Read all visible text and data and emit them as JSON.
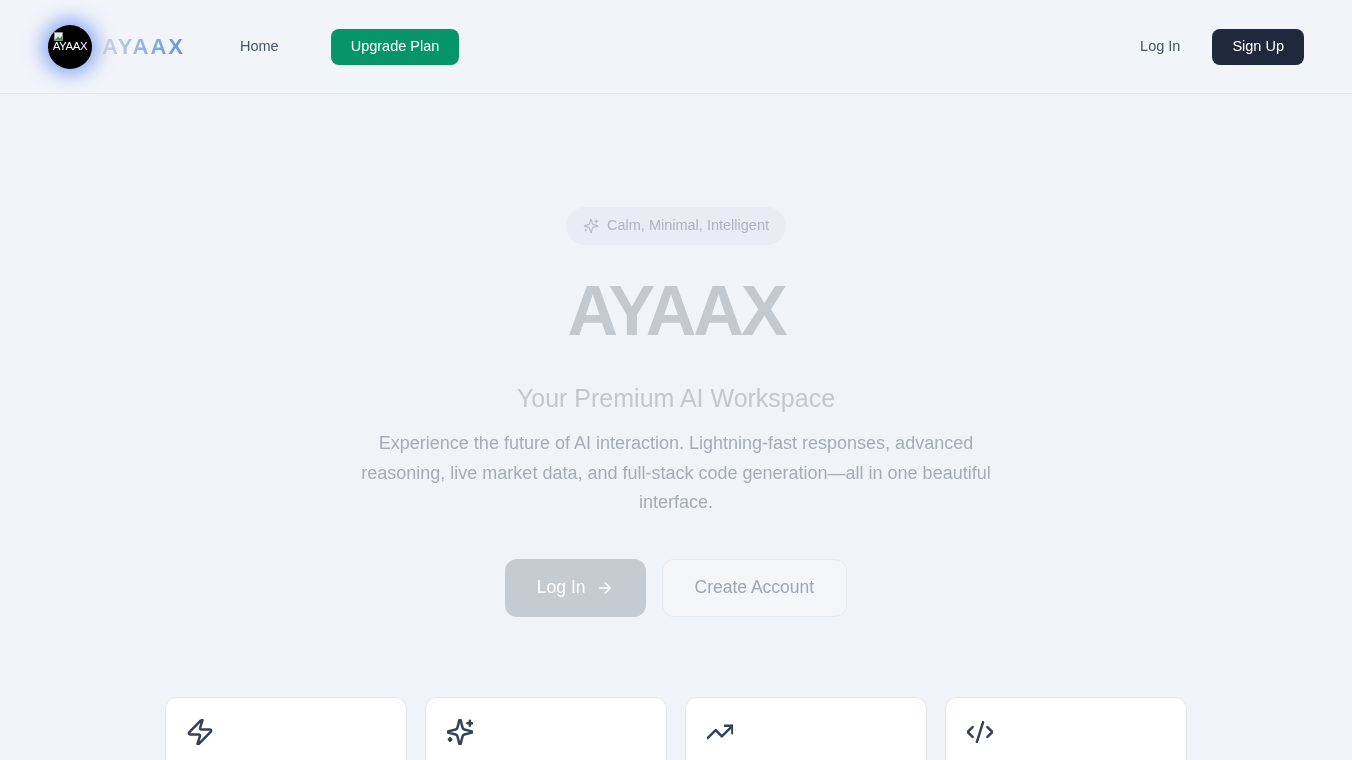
{
  "nav": {
    "logo_alt": "AYAAX",
    "brand": "AYAAX",
    "links": [
      {
        "label": "Home",
        "kind": "link"
      },
      {
        "label": "Upgrade Plan",
        "kind": "upgrade"
      }
    ],
    "auth": [
      {
        "label": "Log In",
        "kind": "link"
      },
      {
        "label": "Sign Up",
        "kind": "primary"
      }
    ]
  },
  "hero": {
    "badge": "Calm, Minimal, Intelligent",
    "title": "AYAAX",
    "subtitle": "Your Premium AI Workspace",
    "description": "Experience the future of AI interaction. Lightning-fast responses, advanced reasoning, live market data, and full-stack code generation—all in one beautiful interface.",
    "actions": [
      {
        "label": "Log In",
        "kind": "primary"
      },
      {
        "label": "Create Account",
        "kind": "secondary"
      }
    ]
  },
  "features": [
    {
      "kind": "bolt"
    },
    {
      "kind": "sparkles"
    },
    {
      "kind": "trend"
    },
    {
      "kind": "code"
    }
  ]
}
